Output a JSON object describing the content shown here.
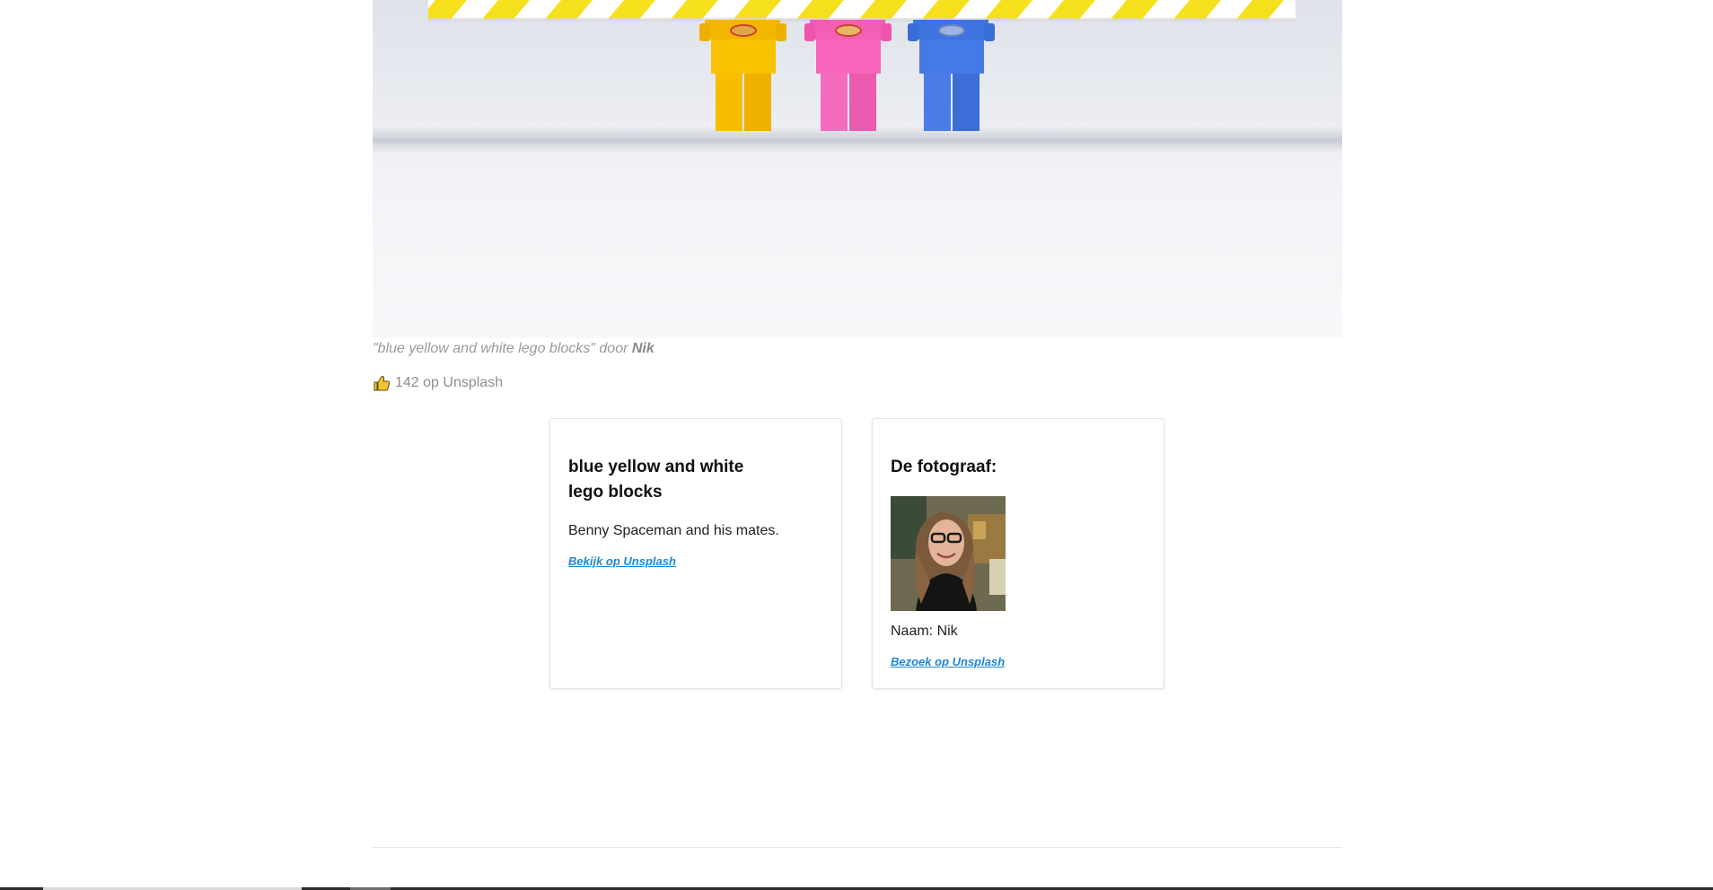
{
  "photo": {
    "alt": "blue yellow and white lego blocks",
    "caption_text": "\"blue yellow and white lego blocks\" door ",
    "caption_author": "Nik",
    "likes_text": "142 op Unsplash",
    "likes_icon": "thumbs-up-icon"
  },
  "photo_card": {
    "title": "blue yellow and white lego blocks",
    "description": "Benny Spaceman and his mates.",
    "link_label": "Bekijk op Unsplash"
  },
  "photographer_card": {
    "title": "De fotograaf:",
    "name_text": "Naam: Nik",
    "link_label": "Bezoek op Unsplash"
  },
  "colors": {
    "link": "#1d87d6",
    "caption": "#9a9a9a"
  }
}
